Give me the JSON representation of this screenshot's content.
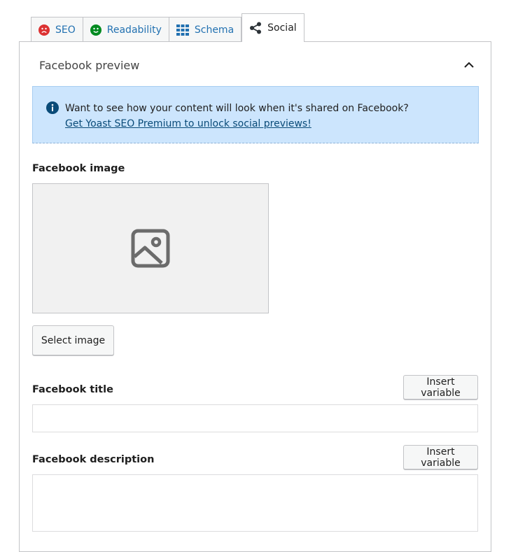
{
  "tabs": [
    {
      "label": "SEO",
      "icon": "sad-face-icon",
      "icon_color": "#dc3232"
    },
    {
      "label": "Readability",
      "icon": "smiley-face-icon",
      "icon_color": "#008a20"
    },
    {
      "label": "Schema",
      "icon": "grid-icon",
      "icon_color": "#2271b1"
    },
    {
      "label": "Social",
      "icon": "share-icon",
      "icon_color": "#1e1e1e",
      "active": true
    }
  ],
  "panel": {
    "title": "Facebook preview",
    "alert": {
      "text": "Want to see how your content will look when it's shared on Facebook?",
      "link": "Get Yoast SEO Premium to unlock social previews!"
    },
    "image_label": "Facebook image",
    "select_image_label": "Select image",
    "title_label": "Facebook title",
    "title_value": "",
    "description_label": "Facebook description",
    "description_value": "",
    "insert_variable_label": "Insert variable"
  }
}
